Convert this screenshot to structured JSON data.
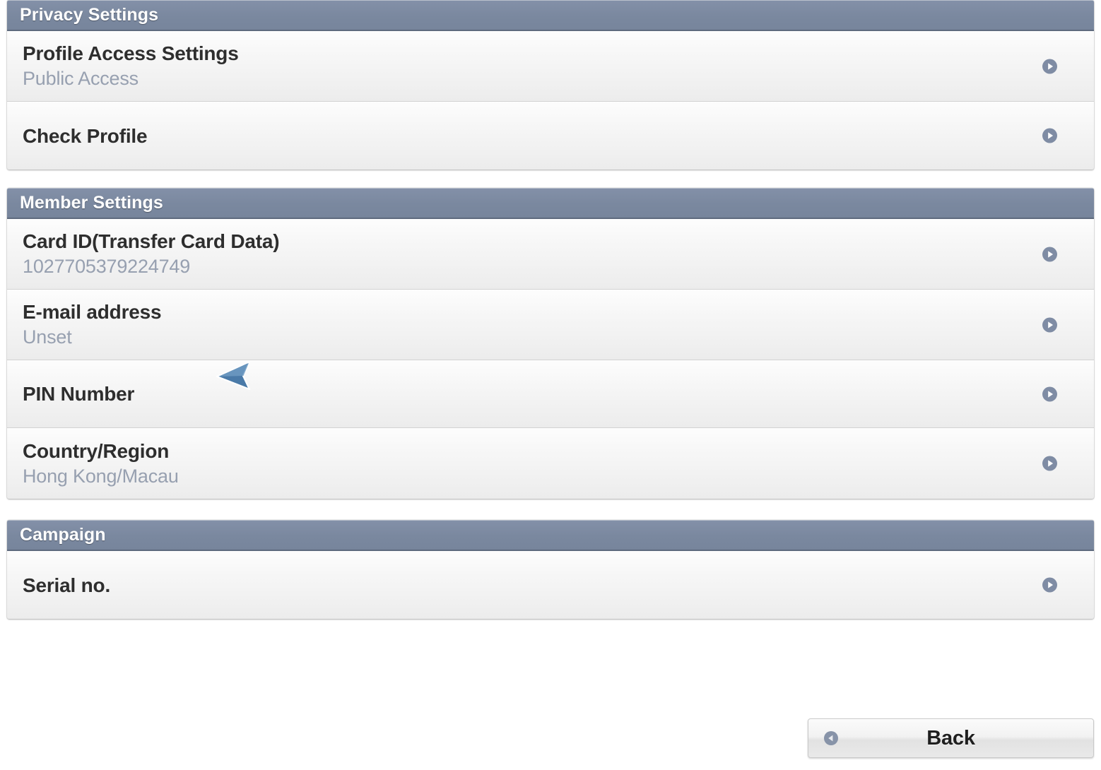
{
  "sections": [
    {
      "id": "privacy-settings",
      "header": "Privacy Settings",
      "rows": [
        {
          "id": "profile-access-settings",
          "title": "Profile Access Settings",
          "subtitle": "Public Access",
          "disclosure_icon": "play-circle-icon"
        },
        {
          "id": "check-profile",
          "title": "Check Profile",
          "subtitle": "",
          "disclosure_icon": "play-circle-icon"
        }
      ]
    },
    {
      "id": "member-settings",
      "header": "Member Settings",
      "rows": [
        {
          "id": "card-id",
          "title": "Card ID(Transfer Card Data)",
          "subtitle": "1027705379224749",
          "disclosure_icon": "play-circle-icon"
        },
        {
          "id": "email-address",
          "title": "E-mail address",
          "subtitle": "Unset",
          "disclosure_icon": "play-circle-icon"
        },
        {
          "id": "pin-number",
          "title": "PIN Number",
          "subtitle": "",
          "disclosure_icon": "play-circle-icon"
        },
        {
          "id": "country-region",
          "title": "Country/Region",
          "subtitle": "Hong Kong/Macau",
          "disclosure_icon": "play-circle-icon"
        }
      ]
    },
    {
      "id": "campaign",
      "header": "Campaign",
      "rows": [
        {
          "id": "serial-no",
          "title": "Serial no.",
          "subtitle": "",
          "disclosure_icon": "play-circle-icon"
        }
      ]
    }
  ],
  "footer": {
    "back_label": "Back",
    "back_icon": "play-circle-left-icon"
  },
  "cursor": {
    "icon": "mouse-pointer-left-icon"
  },
  "colors": {
    "header_bar": "#7a889f",
    "header_text": "#ffffff",
    "row_title": "#2e2e2e",
    "row_subtitle": "#97a0b0",
    "disclosure": "#7f8ca4",
    "page_background": "#ffffff",
    "cursor_fill": "#4a7aa8"
  }
}
